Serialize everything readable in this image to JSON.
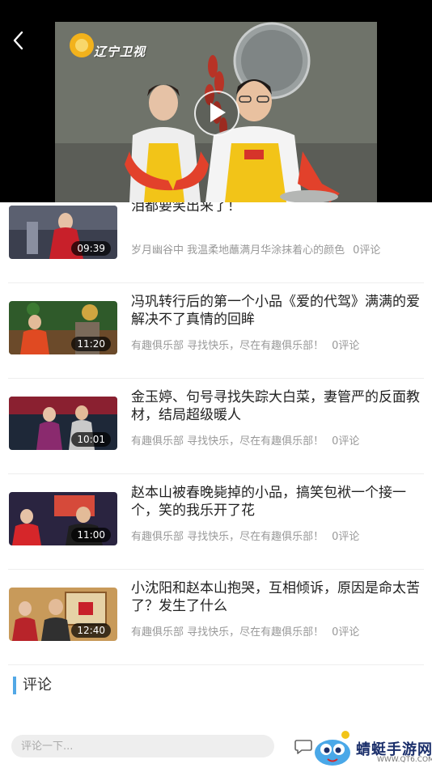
{
  "player": {
    "channel_logo_text": "辽宁卫视"
  },
  "videos": [
    {
      "title": "泪都要笑出来了！",
      "duration": "09:39",
      "source": "岁月幽谷中 我温柔地蘸满月华涂抹着心的颜色",
      "comments": "0评论"
    },
    {
      "title": "冯巩转行后的第一个小品《爱的代驾》满满的爱解决不了真情的回眸",
      "duration": "11:20",
      "source": "有趣俱乐部 寻找快乐，尽在有趣俱乐部！",
      "comments": "0评论"
    },
    {
      "title": "金玉婷、句号寻找失踪大白菜，妻管严的反面教材，结局超级暖人",
      "duration": "10:01",
      "source": "有趣俱乐部 寻找快乐，尽在有趣俱乐部！",
      "comments": "0评论"
    },
    {
      "title": "赵本山被春晚毙掉的小品，搞笑包袱一个接一个，笑的我乐开了花",
      "duration": "11:00",
      "source": "有趣俱乐部 寻找快乐，尽在有趣俱乐部！",
      "comments": "0评论"
    },
    {
      "title": "小沈阳和赵本山抱哭，互相倾诉，原因是命太苦了？发生了什么",
      "duration": "12:40",
      "source": "有趣俱乐部 寻找快乐，尽在有趣俱乐部！",
      "comments": "0评论"
    }
  ],
  "comments_section": {
    "heading": "评论",
    "input_placeholder": "评论一下..."
  },
  "watermark": {
    "text": "蜻蜓手游网",
    "url": "WWW.QT6.COM"
  },
  "colors": {
    "accent": "#52a8e6",
    "meta_text": "#999999",
    "player_bg": "#000000"
  }
}
